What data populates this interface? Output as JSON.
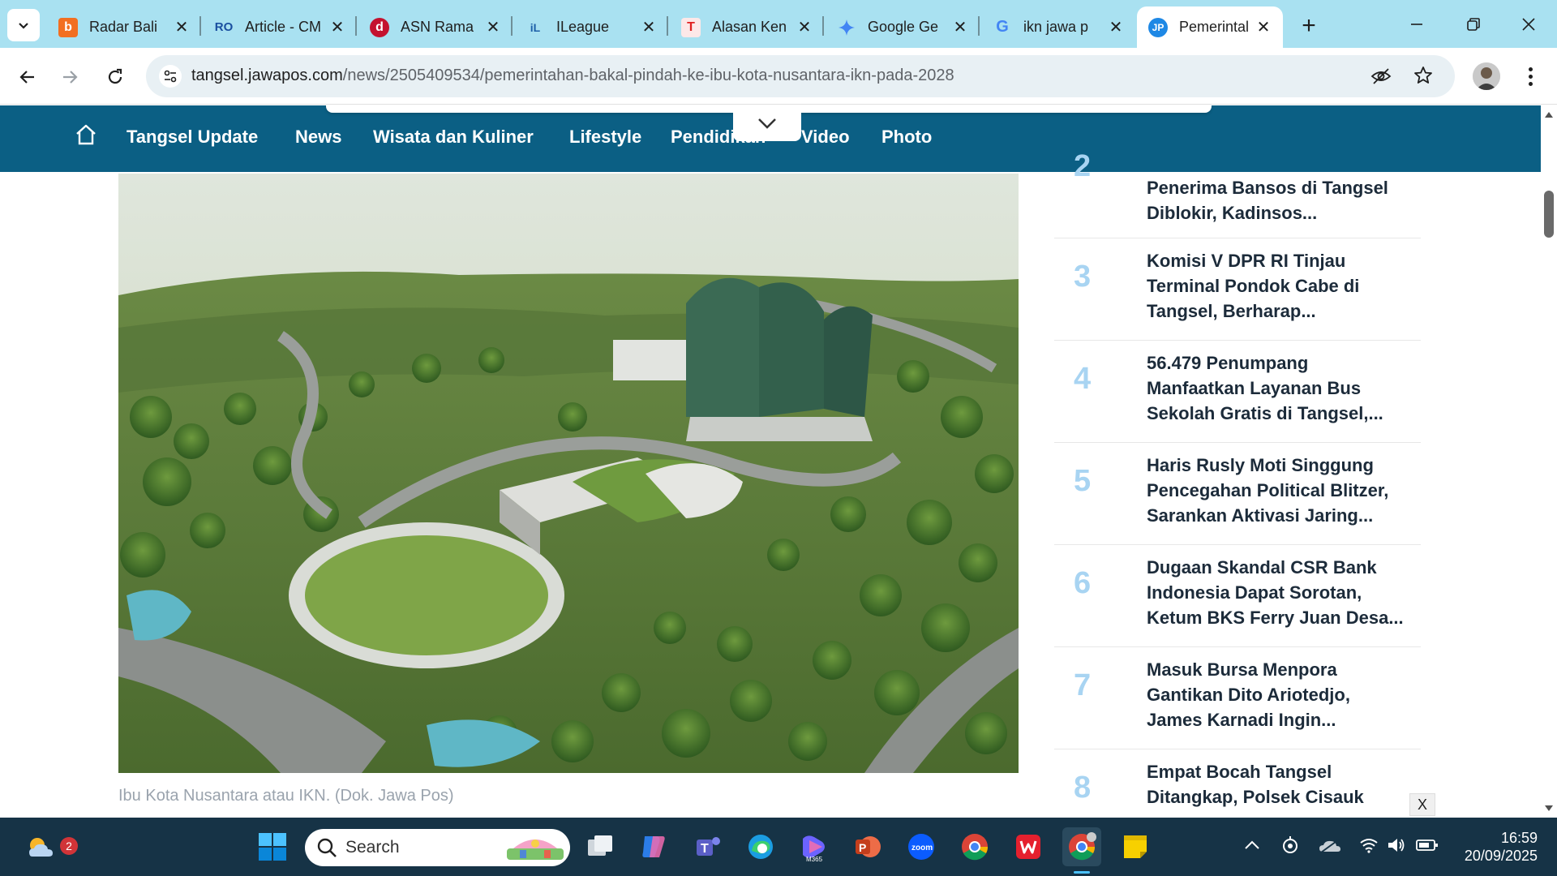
{
  "browser": {
    "tabs": [
      {
        "title": "Radar Bali",
        "icon": "radar-bali-favicon",
        "color": "#f26f21"
      },
      {
        "title": "Article - CM",
        "icon": "article-cms-favicon",
        "color": "#1a4fa0"
      },
      {
        "title": "ASN Rama",
        "icon": "detik-favicon",
        "color": "#c4122f"
      },
      {
        "title": "ILeague",
        "icon": "ileague-favicon",
        "color": "#1d5fa8"
      },
      {
        "title": "Alasan Ken",
        "icon": "t-favicon",
        "color": "#e02020"
      },
      {
        "title": "Google Ge",
        "icon": "gemini-favicon",
        "color": "#4285f4"
      },
      {
        "title": "ikn jawa p",
        "icon": "google-favicon",
        "color": "#4285f4"
      },
      {
        "title": "Pemerintal",
        "icon": "jawapos-favicon",
        "color": "#1e88e5"
      }
    ],
    "url_host": "tangsel.jawapos.com",
    "url_path": "/news/2505409534/pemerintahan-bakal-pindah-ke-ibu-kota-nusantara-ikn-pada-2028"
  },
  "site_nav": {
    "links": [
      "Tangsel Update",
      "News",
      "Wisata dan Kuliner",
      "Lifestyle",
      "Pendidikan",
      "Video",
      "Photo"
    ]
  },
  "article": {
    "caption": "Ibu Kota Nusantara atau IKN. (Dok. Jawa Pos)"
  },
  "trending": [
    {
      "num": "2",
      "title": "Penerima Bansos di Tangsel Diblokir, Kadinsos..."
    },
    {
      "num": "3",
      "title": "Komisi V DPR RI Tinjau Terminal Pondok Cabe di Tangsel, Berharap..."
    },
    {
      "num": "4",
      "title": "56.479 Penumpang Manfaatkan Layanan Bus Sekolah Gratis di Tangsel,..."
    },
    {
      "num": "5",
      "title": "Haris Rusly Moti Singgung Pencegahan Political Blitzer, Sarankan Aktivasi Jaring..."
    },
    {
      "num": "6",
      "title": "Dugaan Skandal CSR Bank Indonesia Dapat Sorotan, Ketum BKS Ferry Juan Desa..."
    },
    {
      "num": "7",
      "title": "Masuk Bursa Menpora Gantikan Dito Ariotedjo, James Karnadi Ingin..."
    },
    {
      "num": "8",
      "title": "Empat Bocah Tangsel Ditangkap, Polsek Cisauk"
    }
  ],
  "ad_close": "X",
  "taskbar": {
    "search_placeholder": "Search",
    "weather_badge": "2",
    "time": "16:59",
    "date": "20/09/2025"
  }
}
